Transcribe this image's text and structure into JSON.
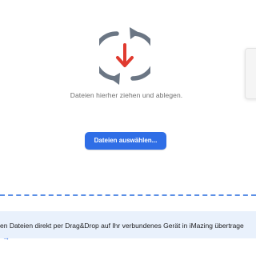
{
  "drop_zone": {
    "hint": "Dateien hierher ziehen und ablegen.",
    "sync_icon": "sync-download-icon",
    "select_button_label": "Dateien auswählen..."
  },
  "info_banner": {
    "text": "en Dateien direkt per Drag&Drop auf Ihr verbundenes Gerät in iMazing übertrage",
    "link_arrow": "→"
  },
  "colors": {
    "accent": "#2f6ee6",
    "icon_arrow": "#e03a2f",
    "icon_ring": "#6b7684",
    "banner_bg": "#e9f1fc",
    "dashed_divider": "#5b8fe6"
  }
}
